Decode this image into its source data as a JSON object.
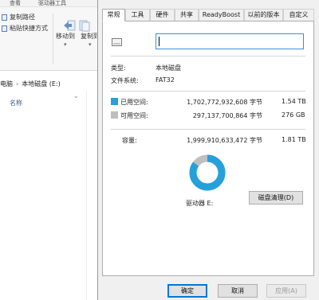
{
  "explorer": {
    "ribbon_tabs": [
      "查看",
      "驱动器工具"
    ],
    "commands": {
      "copy_path": "复制路径",
      "paste_shortcut": "粘贴快捷方式",
      "move_to": "移动到",
      "copy_to": "复制到"
    },
    "path": {
      "item1": "电脑",
      "item2": "本地磁盘 (E:)"
    },
    "column_header": "名称"
  },
  "dialog": {
    "tabs": [
      "常规",
      "工具",
      "硬件",
      "共享",
      "ReadyBoost",
      "以前的版本",
      "自定义"
    ],
    "active_tab": "常规",
    "name_value": "",
    "type_label": "类型:",
    "type_value": "本地磁盘",
    "fs_label": "文件系统:",
    "fs_value": "FAT32",
    "used": {
      "label": "已用空间:",
      "bytes": "1,702,772,932,608 字节",
      "size": "1.54 TB"
    },
    "free": {
      "label": "可用空间:",
      "bytes": "297,137,700,864 字节",
      "size": "276 GB"
    },
    "capacity": {
      "label": "容量:",
      "bytes": "1,999,910,633,472 字节",
      "size": "1.81 TB"
    },
    "used_fraction": 0.851,
    "drive_label": "驱动器 E:",
    "cleanup_button": "磁盘清理(D)",
    "ok_button": "确定",
    "cancel_button": "取消",
    "apply_button": "应用(A)"
  },
  "colors": {
    "used": "#26a0da",
    "free": "#bfbfbf",
    "accent": "#0078d7"
  },
  "icons": [
    "copy-path-icon",
    "paste-shortcut-icon",
    "move-to-icon",
    "copy-to-icon",
    "drive-icon"
  ]
}
